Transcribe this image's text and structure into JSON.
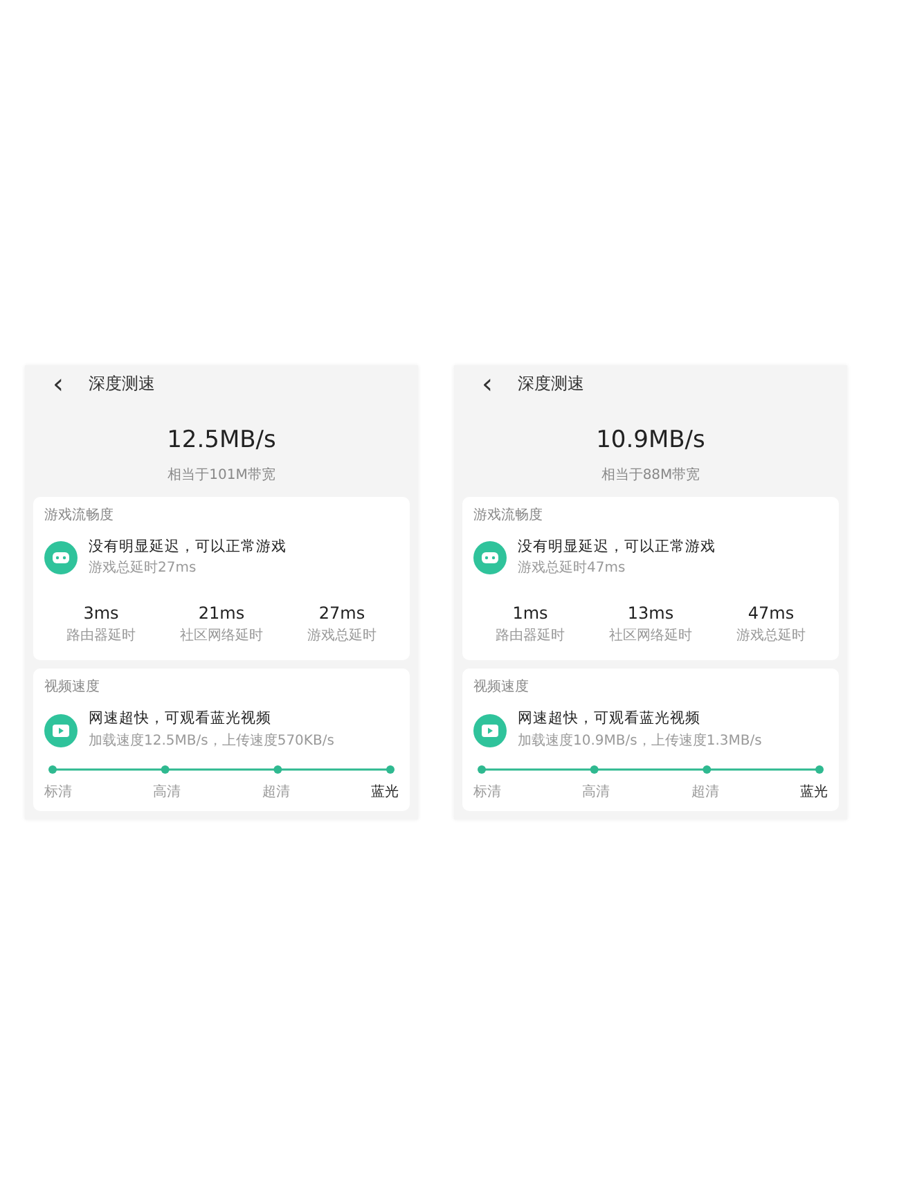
{
  "screens": [
    {
      "title": "深度测速",
      "back": "‹",
      "speed": "12.5MB/s",
      "bandwidth": "相当于101M带宽",
      "game": {
        "heading": "游戏流畅度",
        "verdict": "没有明显延迟，可以正常游戏",
        "detail": "游戏总延时27ms",
        "stats": [
          {
            "value": "3ms",
            "label": "路由器延时"
          },
          {
            "value": "21ms",
            "label": "社区网络延时"
          },
          {
            "value": "27ms",
            "label": "游戏总延时"
          }
        ]
      },
      "video": {
        "heading": "视频速度",
        "verdict": "网速超快，可观看蓝光视频",
        "detail": "加载速度12.5MB/s，上传速度570KB/s",
        "levels": [
          {
            "label": "标清",
            "selected": false
          },
          {
            "label": "高清",
            "selected": false
          },
          {
            "label": "超清",
            "selected": false
          },
          {
            "label": "蓝光",
            "selected": true
          }
        ]
      }
    },
    {
      "title": "深度测速",
      "back": "‹",
      "speed": "10.9MB/s",
      "bandwidth": "相当于88M带宽",
      "game": {
        "heading": "游戏流畅度",
        "verdict": "没有明显延迟，可以正常游戏",
        "detail": "游戏总延时47ms",
        "stats": [
          {
            "value": "1ms",
            "label": "路由器延时"
          },
          {
            "value": "13ms",
            "label": "社区网络延时"
          },
          {
            "value": "47ms",
            "label": "游戏总延时"
          }
        ]
      },
      "video": {
        "heading": "视频速度",
        "verdict": "网速超快，可观看蓝光视频",
        "detail": "加载速度10.9MB/s，上传速度1.3MB/s",
        "levels": [
          {
            "label": "标清",
            "selected": false
          },
          {
            "label": "高清",
            "selected": false
          },
          {
            "label": "超清",
            "selected": false
          },
          {
            "label": "蓝光",
            "selected": true
          }
        ]
      }
    }
  ]
}
